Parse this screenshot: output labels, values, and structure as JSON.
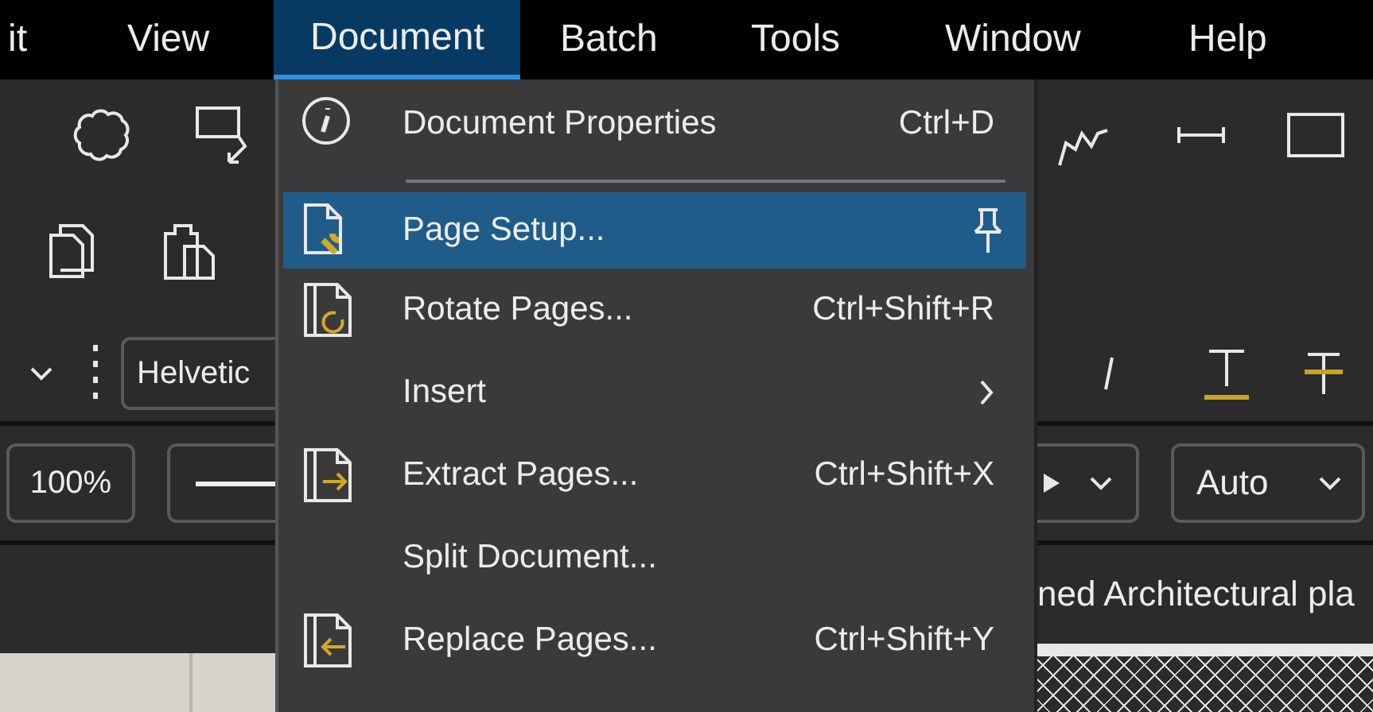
{
  "menu_bar": {
    "items": [
      {
        "label": "it",
        "selected": false
      },
      {
        "label": "View",
        "selected": false
      },
      {
        "label": "Document",
        "selected": true
      },
      {
        "label": "Batch",
        "selected": false
      },
      {
        "label": "Tools",
        "selected": false
      },
      {
        "label": "Window",
        "selected": false
      },
      {
        "label": "Help",
        "selected": false
      }
    ]
  },
  "document_menu": {
    "items": [
      {
        "kind": "item",
        "label": "Document Properties",
        "shortcut": "Ctrl+D",
        "selected": false,
        "submenu": false
      },
      {
        "kind": "separator"
      },
      {
        "kind": "item",
        "label": "Page Setup...",
        "selected": true,
        "submenu": false
      },
      {
        "kind": "item",
        "label": "Rotate Pages...",
        "shortcut": "Ctrl+Shift+R",
        "selected": false,
        "submenu": false
      },
      {
        "kind": "item",
        "label": "Insert",
        "selected": false,
        "submenu": true
      },
      {
        "kind": "item",
        "label": "Extract Pages...",
        "shortcut": "Ctrl+Shift+X",
        "selected": false,
        "submenu": false
      },
      {
        "kind": "item",
        "label": "Split Document...",
        "selected": false,
        "submenu": false
      },
      {
        "kind": "item",
        "label": "Replace Pages...",
        "shortcut": "Ctrl+Shift+Y",
        "selected": false,
        "submenu": false
      }
    ]
  },
  "toolbar": {
    "font_field": {
      "value": "Helvetic"
    },
    "zoom_field": {
      "value": "100%"
    },
    "auto_dropdown": {
      "value": "Auto"
    }
  },
  "document_tab": {
    "title": "ned Architectural pla"
  }
}
